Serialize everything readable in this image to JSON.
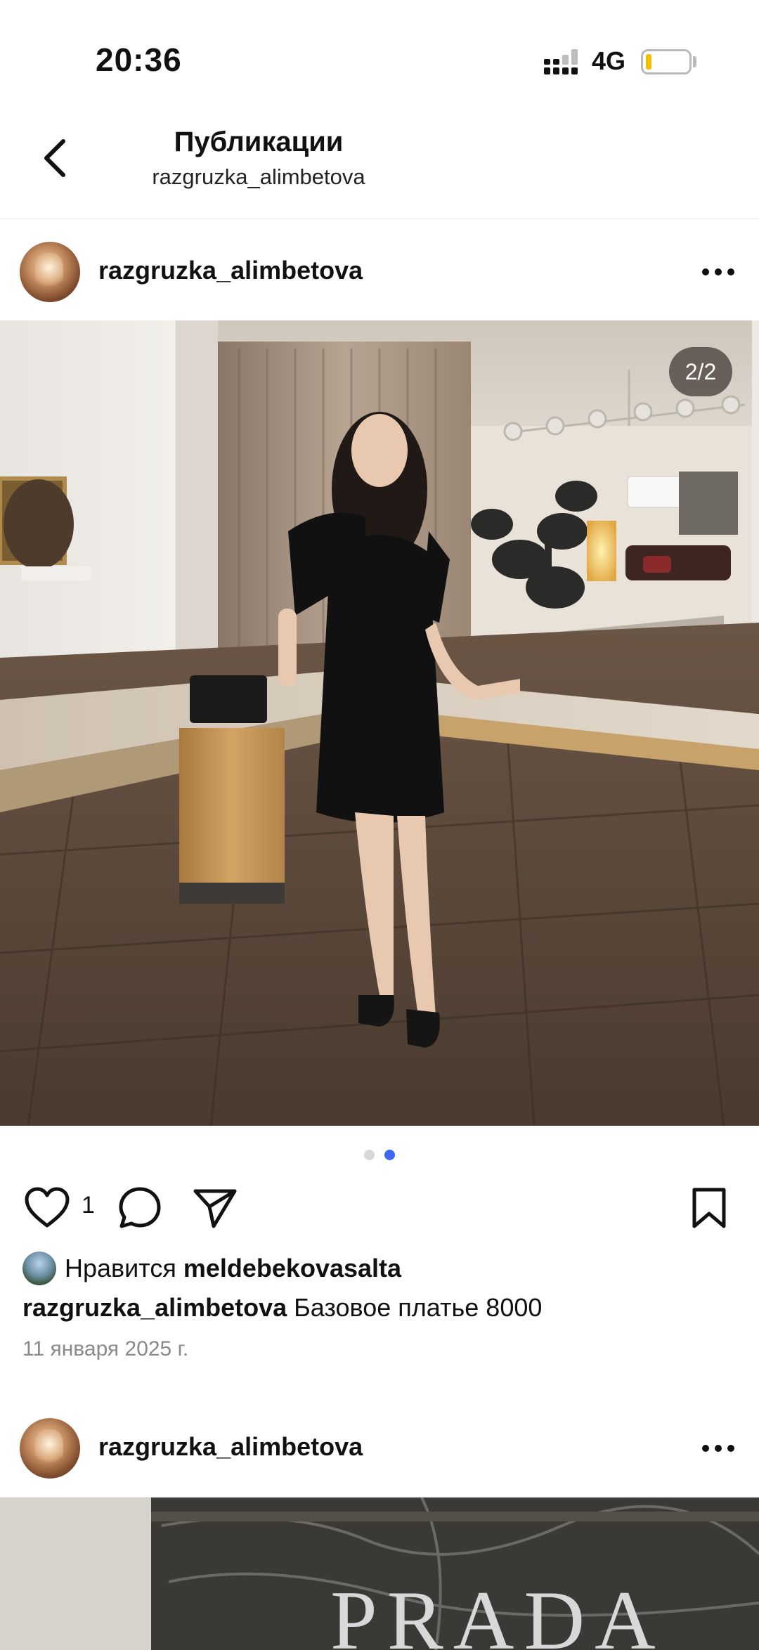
{
  "status": {
    "time": "20:36",
    "network": "4G"
  },
  "header": {
    "title": "Публикации",
    "subtitle": "razgruzka_alimbetova"
  },
  "post1": {
    "username": "razgruzka_alimbetova",
    "counter": "2/2",
    "like_count": "1",
    "likes_prefix": "Нравится",
    "liked_by": "meldebekovasalta",
    "caption_user": "razgruzka_alimbetova",
    "caption_text": "Базовое платье 8000",
    "date": "11 января 2025 г.",
    "carousel": {
      "total": 2,
      "active": 2
    }
  },
  "post2": {
    "username": "razgruzka_alimbetova",
    "partial_text": "PRADA"
  },
  "colors": {
    "accent_dot": "#3e66f2",
    "battery": "#f2c200"
  },
  "icons": [
    "back-arrow-icon",
    "more-icon",
    "heart-icon",
    "comment-icon",
    "share-icon",
    "bookmark-icon"
  ]
}
